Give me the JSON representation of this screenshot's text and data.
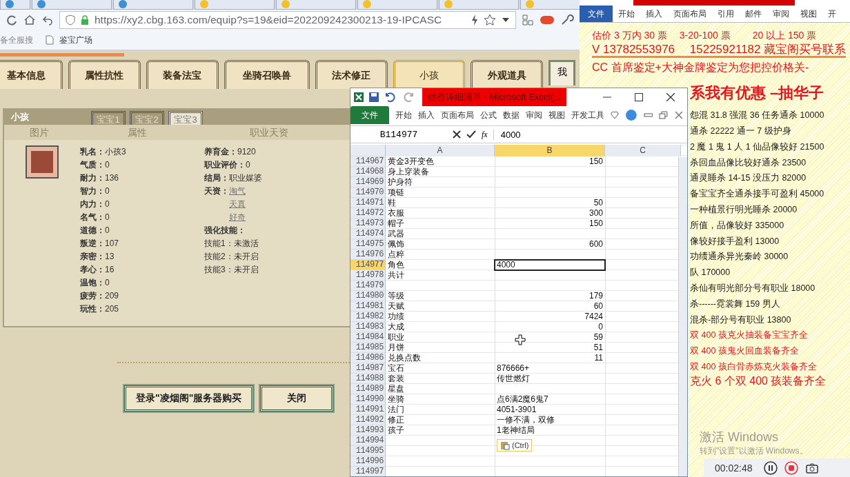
{
  "browser": {
    "url": "https://xy2.cbg.163.com/equip?s=19&eid=202209242300213-19-IPCASC",
    "bookmarks": [
      "备全服搜",
      "鉴宝广场"
    ],
    "game_tabs": [
      {
        "label": "基本信息",
        "selected": false
      },
      {
        "label": "属性抗性",
        "selected": false
      },
      {
        "label": "装备法宝",
        "selected": false
      },
      {
        "label": "坐骑召唤兽",
        "selected": false
      },
      {
        "label": "法术修正",
        "selected": false
      },
      {
        "label": "小孩",
        "selected": true
      },
      {
        "label": "外观道具",
        "selected": false
      }
    ],
    "side_button": "我",
    "panel": {
      "title": "小孩",
      "tabs": [
        {
          "label": "宝宝1",
          "selected": false
        },
        {
          "label": "宝宝2",
          "selected": false
        },
        {
          "label": "宝宝3",
          "selected": true
        }
      ],
      "headers": [
        "图片",
        "属性",
        "职业天资"
      ],
      "attributes": [
        {
          "label": "乳名：",
          "value": "小孩3"
        },
        {
          "label": "气质：",
          "value": "0"
        },
        {
          "label": "耐力：",
          "value": "136"
        },
        {
          "label": "智力：",
          "value": "0"
        },
        {
          "label": "内力：",
          "value": "0"
        },
        {
          "label": "名气：",
          "value": "0"
        },
        {
          "label": "道德：",
          "value": "0"
        },
        {
          "label": "叛逆：",
          "value": "107"
        },
        {
          "label": "亲密：",
          "value": "13"
        },
        {
          "label": "孝心：",
          "value": "16"
        },
        {
          "label": "温饱：",
          "value": "0"
        },
        {
          "label": "疲劳：",
          "value": "209"
        },
        {
          "label": "玩性：",
          "value": "205"
        }
      ],
      "career": [
        {
          "kind": "field",
          "label": "养育金：",
          "value": "9120"
        },
        {
          "kind": "field",
          "label": "职业评价：",
          "value": "0"
        },
        {
          "kind": "field",
          "label": "结局：",
          "value": "职业媒婆"
        },
        {
          "kind": "talents",
          "label": "天资：",
          "links": [
            "淘气",
            "天真",
            "好奇"
          ]
        },
        {
          "kind": "heading",
          "label": "强化技能："
        },
        {
          "kind": "skill",
          "label": "技能1：",
          "value": "未激活"
        },
        {
          "kind": "skill",
          "label": "技能2：",
          "value": "未开启"
        },
        {
          "kind": "skill",
          "label": "技能3：",
          "value": "未开启"
        }
      ]
    },
    "buttons": [
      "登录\"凌烟阁\"服务器购买",
      "关闭"
    ]
  },
  "excel": {
    "title": "估价详细清单 - Microsoft Excel(...",
    "ribbon_tabs": [
      {
        "label": "文件",
        "selected": true
      },
      {
        "label": "开始",
        "selected": false
      },
      {
        "label": "插入",
        "selected": false
      },
      {
        "label": "页面布局",
        "selected": false
      },
      {
        "label": "公式",
        "selected": false
      },
      {
        "label": "数据",
        "selected": false
      },
      {
        "label": "审阅",
        "selected": false
      },
      {
        "label": "视图",
        "selected": false
      },
      {
        "label": "开发工具",
        "selected": false
      }
    ],
    "name_box": "B114977",
    "function_label": "fx",
    "formula": "4000",
    "columns": [
      {
        "label": "A",
        "selected": false
      },
      {
        "label": "B",
        "selected": true
      },
      {
        "label": "C",
        "selected": false
      }
    ],
    "rows": [
      {
        "n": "114967",
        "a": "黄金3开变色",
        "b": "150",
        "kind": "number",
        "selected": false
      },
      {
        "n": "114968",
        "a": "身上穿装备",
        "selected": false
      },
      {
        "n": "114969",
        "a": "护身符",
        "selected": false
      },
      {
        "n": "114970",
        "a": "项链",
        "selected": false
      },
      {
        "n": "114971",
        "a": "鞋",
        "b": "50",
        "kind": "number",
        "selected": false
      },
      {
        "n": "114972",
        "a": "衣服",
        "b": "300",
        "kind": "number",
        "selected": false
      },
      {
        "n": "114973",
        "a": "帽子",
        "b": "150",
        "kind": "number",
        "selected": false
      },
      {
        "n": "114974",
        "a": "武器",
        "selected": false
      },
      {
        "n": "114975",
        "a": "佩饰",
        "b": "600",
        "kind": "number",
        "selected": false
      },
      {
        "n": "114976",
        "a": "点粹",
        "selected": false
      },
      {
        "n": "114977",
        "a": "角色",
        "b": "4000",
        "kind": "text",
        "selected": true
      },
      {
        "n": "114978",
        "a": "共计",
        "selected": false
      },
      {
        "n": "114979",
        "selected": false
      },
      {
        "n": "114980",
        "a": "等级",
        "b": "179",
        "kind": "number",
        "selected": false
      },
      {
        "n": "114981",
        "a": "天赋",
        "b": "60",
        "kind": "number",
        "selected": false
      },
      {
        "n": "114982",
        "a": "功绩",
        "b": "7424",
        "kind": "number",
        "selected": false
      },
      {
        "n": "114983",
        "a": "大成",
        "b": "0",
        "kind": "number",
        "selected": false
      },
      {
        "n": "114984",
        "a": "职业",
        "b": "59",
        "kind": "number",
        "selected": false
      },
      {
        "n": "114985",
        "a": "月饼",
        "b": "51",
        "kind": "number",
        "selected": false
      },
      {
        "n": "114986",
        "a": "兑换点数",
        "b": "11",
        "kind": "number",
        "selected": false
      },
      {
        "n": "114987",
        "a": "宝石",
        "b": "876666+",
        "kind": "text",
        "selected": false
      },
      {
        "n": "114988",
        "a": "套装",
        "b": "传世燃灯",
        "kind": "text",
        "selected": false
      },
      {
        "n": "114989",
        "a": "星盘",
        "selected": false
      },
      {
        "n": "114990",
        "a": "坐骑",
        "b": "点6满2魔6鬼7",
        "kind": "text",
        "selected": false
      },
      {
        "n": "114991",
        "a": "法门",
        "b": "4051-3901",
        "kind": "text",
        "selected": false
      },
      {
        "n": "114992",
        "a": "修正",
        "b": "一修不满，双修",
        "kind": "text",
        "selected": false
      },
      {
        "n": "114993",
        "a": "孩子",
        "b": "1老神结局",
        "kind": "text",
        "selected": false
      },
      {
        "n": "114994",
        "selected": false
      },
      {
        "n": "114995",
        "selected": false
      },
      {
        "n": "114996",
        "selected": false
      },
      {
        "n": "114997",
        "selected": false
      }
    ],
    "paste_options": "(Ctrl)"
  },
  "word": {
    "ribbon_tabs": [
      {
        "label": "文件",
        "selected": true
      },
      {
        "label": "开始",
        "selected": false
      },
      {
        "label": "插入",
        "selected": false
      },
      {
        "label": "页面布局",
        "selected": false
      },
      {
        "label": "引用",
        "selected": false
      },
      {
        "label": "邮件",
        "selected": false
      },
      {
        "label": "审阅",
        "selected": false
      },
      {
        "label": "视图",
        "selected": false
      },
      {
        "label": "开",
        "selected": false
      }
    ],
    "top_lines": [
      {
        "kind": "small",
        "text": "估价 3 万内 30 票　 3-20-100 票　　 20 以上 150 票",
        "color": "#e8141e"
      },
      {
        "kind": "struck",
        "text": "V 13782553976　 15225921182 藏宝阁买号联系",
        "color": "#e8141e"
      },
      {
        "kind": "medium",
        "text": "CC 首席鉴定+大神金牌鉴定为您把控价格关-",
        "color": "#e8141e"
      }
    ],
    "lines": [
      {
        "kind": "title",
        "text": "系我有优惠 –抽华子",
        "color": "#e8141e"
      },
      {
        "kind": "body",
        "text": "怨混 31.8 强混 36 任务通杀 10000",
        "color": "#1a1a1a"
      },
      {
        "kind": "body",
        "text": "通杀 22222 通一 7 级护身",
        "color": "#1a1a1a"
      },
      {
        "kind": "body",
        "text": "2 魔 1 鬼 1 人 1 仙品像较好 21500",
        "color": "#1a1a1a"
      },
      {
        "kind": "body",
        "text": "杀回血品像比较好通杀 23500",
        "color": "#1a1a1a"
      },
      {
        "kind": "body",
        "text": "通灵睡杀 14-15 没压力 82000",
        "color": "#1a1a1a"
      },
      {
        "kind": "body",
        "text": "备宝宝齐全通杀接手可盈利 45000",
        "color": "#1a1a1a"
      },
      {
        "kind": "body",
        "text": "一种植景行明光睡杀 20000",
        "color": "#1a1a1a"
      },
      {
        "kind": "body",
        "text": "所值，品像较好 335000",
        "color": "#1a1a1a"
      },
      {
        "kind": "body",
        "text": "像较好接手盈利 13000",
        "color": "#1a1a1a"
      },
      {
        "kind": "body",
        "text": "功绩通杀异光秦岭 30000",
        "color": "#1a1a1a"
      },
      {
        "kind": "body",
        "text": "队 170000",
        "color": "#1a1a1a"
      },
      {
        "kind": "body",
        "text": "杀仙有明光部分号有职业 18000",
        "color": "#1a1a1a"
      },
      {
        "kind": "body",
        "text": "杀------霓裳舞 159 男人",
        "color": "#1a1a1a"
      },
      {
        "kind": "body",
        "text": "混杀-部分号有职业 13800",
        "color": "#1a1a1a"
      },
      {
        "kind": "body",
        "text": "双 400 孩克火抽装备宝宝齐全",
        "color": "#e8141e"
      },
      {
        "kind": "body",
        "text": "双 400 孩鬼火回血装备齐全",
        "color": "#e8141e"
      },
      {
        "kind": "body",
        "text": "双 400 孩白骨赤炼克火装备齐全",
        "color": "#e8141e"
      },
      {
        "kind": "large",
        "text": "克火 6 个双 400 孩装备齐全",
        "color": "#e8141e"
      }
    ]
  },
  "activation": {
    "title": "激活 Windows",
    "hint": "转到\"设置\"以激活 Windows。"
  },
  "recorder": {
    "time": "00:02:48"
  }
}
